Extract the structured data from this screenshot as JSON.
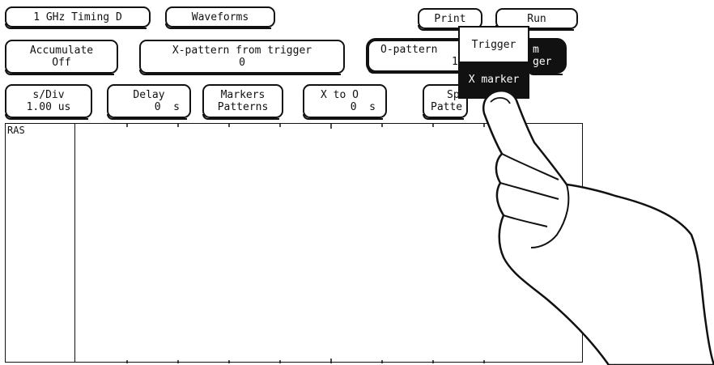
{
  "toolbar": {
    "menu": "1 GHz Timing D",
    "waveforms": "Waveforms",
    "print": "Print",
    "run": "Run"
  },
  "row2": {
    "accumulate_l1": "Accumulate",
    "accumulate_l2": "Off",
    "xpattern_l1": "X-pattern from trigger",
    "xpattern_l2": "0",
    "opattern_l1": "O-pattern",
    "opattern_l2": "1",
    "opattern_tail1": "m",
    "opattern_tail2": "ger"
  },
  "row3": {
    "sdiv_l1": "s/Div",
    "sdiv_l2": "1.00 us",
    "delay_l1": "Delay",
    "delay_l2": "0  s",
    "markers_l1": "Markers",
    "markers_l2": "Patterns",
    "xto0_l1": "X to O",
    "xto0_l2": "0  s",
    "sp_l1": "Sp",
    "sp_l2": "Patte"
  },
  "popup": {
    "item1": "Trigger",
    "item2": "X marker"
  },
  "waveform": {
    "signal": "RAS"
  }
}
